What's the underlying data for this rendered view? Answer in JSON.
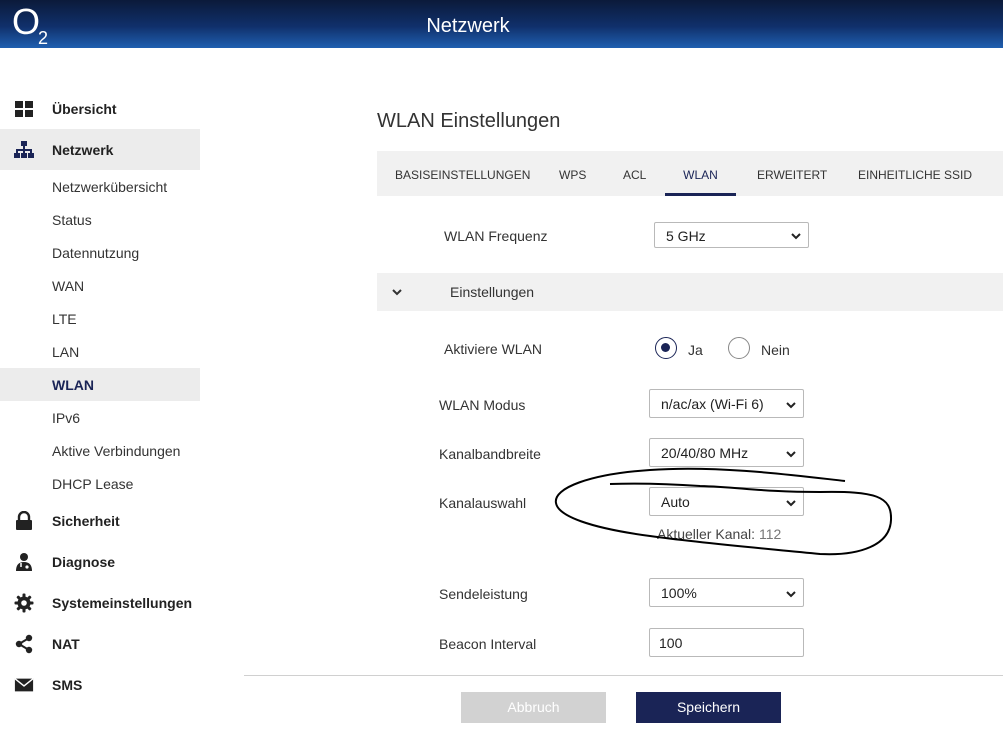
{
  "header": {
    "logo_text": "O",
    "logo_sub": "2",
    "title": "Netzwerk"
  },
  "sidebar": {
    "main": [
      {
        "label": "Übersicht",
        "icon": "dashboard-icon"
      },
      {
        "label": "Netzwerk",
        "icon": "network-icon",
        "active": true
      },
      {
        "label": "Sicherheit",
        "icon": "lock-icon"
      },
      {
        "label": "Diagnose",
        "icon": "doctor-icon"
      },
      {
        "label": "Systemeinstellungen",
        "icon": "gear-icon"
      },
      {
        "label": "NAT",
        "icon": "share-icon"
      },
      {
        "label": "SMS",
        "icon": "mail-icon"
      }
    ],
    "sub": [
      {
        "label": "Netzwerkübersicht"
      },
      {
        "label": "Status"
      },
      {
        "label": "Datennutzung"
      },
      {
        "label": "WAN"
      },
      {
        "label": "LTE"
      },
      {
        "label": "LAN"
      },
      {
        "label": "WLAN",
        "active": true
      },
      {
        "label": "IPv6"
      },
      {
        "label": "Aktive Verbindungen"
      },
      {
        "label": "DHCP Lease"
      }
    ]
  },
  "main": {
    "title": "WLAN Einstellungen",
    "tabs": [
      {
        "label": "BASISEINSTELLUNGEN"
      },
      {
        "label": "WPS"
      },
      {
        "label": "ACL"
      },
      {
        "label": "WLAN",
        "active": true
      },
      {
        "label": "ERWEITERT"
      },
      {
        "label": "EINHEITLICHE SSID"
      }
    ],
    "frequency": {
      "label": "WLAN Frequenz",
      "value": "5 GHz"
    },
    "section": {
      "label": "Einstellungen"
    },
    "activate": {
      "label": "Aktiviere WLAN",
      "yes": "Ja",
      "no": "Nein",
      "selected": "Ja"
    },
    "mode": {
      "label": "WLAN Modus",
      "value": "n/ac/ax (Wi-Fi 6)"
    },
    "bandwidth": {
      "label": "Kanalbandbreite",
      "value": "20/40/80 MHz"
    },
    "channel": {
      "label": "Kanalauswahl",
      "value": "Auto",
      "current_label": "Aktueller Kanal:",
      "current_value": "112"
    },
    "power": {
      "label": "Sendeleistung",
      "value": "100%"
    },
    "beacon": {
      "label": "Beacon Interval",
      "value": "100"
    }
  },
  "footer": {
    "cancel": "Abbruch",
    "save": "Speichern"
  },
  "colors": {
    "accent": "#1a2456",
    "header_top": "#0b1a3a",
    "header_bottom": "#1f5fb0",
    "active_bg": "#ececec"
  }
}
